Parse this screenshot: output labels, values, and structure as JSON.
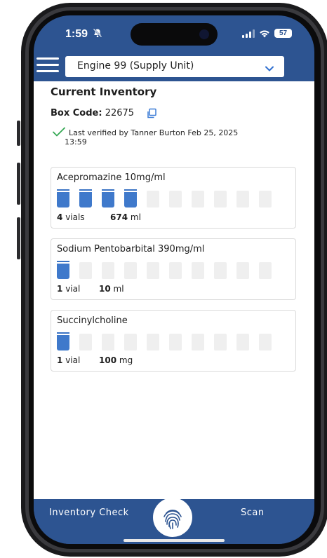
{
  "status_bar": {
    "time": "1:59",
    "battery": "57"
  },
  "header": {
    "unit_selected": "Engine 99 (Supply Unit)"
  },
  "main": {
    "title": "Current Inventory",
    "box_code_label": "Box Code:",
    "box_code_value": "22675",
    "verified_line1": "Last verified by Tanner Burton Feb 25, 2025",
    "verified_line2": "13:59"
  },
  "drugs": [
    {
      "name": "Acepromazine 10mg/ml",
      "count_num": "4",
      "count_unit": "vials",
      "amount_num": "674",
      "amount_unit": "ml",
      "filled_vials": 4,
      "total_vials": 10
    },
    {
      "name": "Sodium Pentobarbital 390mg/ml",
      "count_num": "1",
      "count_unit": "vial",
      "amount_num": "10",
      "amount_unit": "ml",
      "filled_vials": 1,
      "total_vials": 10
    },
    {
      "name": "Succinylcholine",
      "count_num": "1",
      "count_unit": "vial",
      "amount_num": "100",
      "amount_unit": "mg",
      "filled_vials": 1,
      "total_vials": 10
    }
  ],
  "bottom_nav": {
    "inventory_check": "Inventory Check",
    "scan": "Scan"
  },
  "colors": {
    "brand": "#2d5491",
    "vial_fill": "#3f79cb",
    "check": "#34a853"
  }
}
